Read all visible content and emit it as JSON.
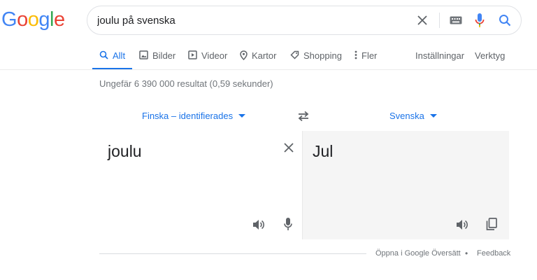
{
  "logo": {
    "letters": [
      "G",
      "o",
      "o",
      "g",
      "l",
      "e"
    ],
    "colors": [
      "#4285F4",
      "#EA4335",
      "#FBBC05",
      "#4285F4",
      "#34A853",
      "#EA4335"
    ]
  },
  "search": {
    "query": "joulu på svenska",
    "icons": [
      "close-icon",
      "keyboard-icon",
      "mic-icon",
      "search-icon"
    ]
  },
  "tabs": [
    {
      "label": "Allt",
      "icon": "search-icon",
      "active": true
    },
    {
      "label": "Bilder",
      "icon": "image-icon"
    },
    {
      "label": "Videor",
      "icon": "play-icon"
    },
    {
      "label": "Kartor",
      "icon": "map-pin-icon"
    },
    {
      "label": "Shopping",
      "icon": "tag-icon"
    },
    {
      "label": "Fler",
      "icon": "more-vert-icon"
    },
    {
      "label": "Inställningar"
    },
    {
      "label": "Verktyg"
    }
  ],
  "stats": "Ungefär 6 390 000 resultat (0,59 sekunder)",
  "translator": {
    "source_lang": "Finska – identifierades",
    "target_lang": "Svenska",
    "source_text": "joulu",
    "translated_text": "Jul"
  },
  "footer": {
    "open_link": "Öppna i Google Översätt",
    "separator": "•",
    "feedback": "Feedback"
  },
  "colors": {
    "accent": "#1a73e8",
    "muted": "#70757a",
    "icon_gray": "#5f6368"
  }
}
